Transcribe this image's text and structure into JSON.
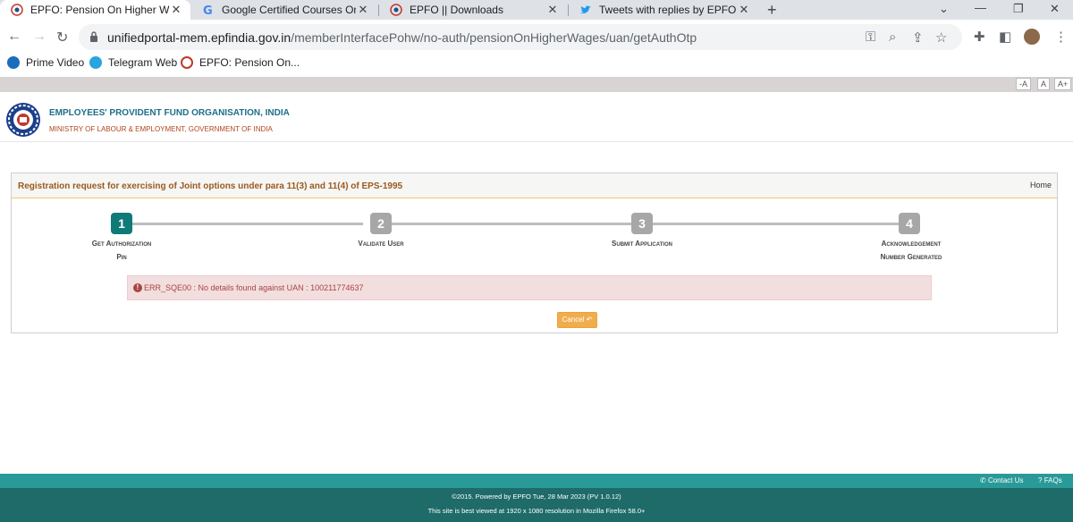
{
  "browser": {
    "tabs": [
      {
        "title": "EPFO: Pension On Higher Wages",
        "active": true
      },
      {
        "title": "Google Certified Courses Online",
        "active": false
      },
      {
        "title": "EPFO || Downloads",
        "active": false
      },
      {
        "title": "Tweets with replies by EPFO (@sc",
        "active": false
      }
    ],
    "new_tab": "+",
    "url_host": "unifiedportal-mem.epfindia.gov.in",
    "url_path": "/memberInterfacePohw/no-auth/pensionOnHigherWages/uan/getAuthOtp",
    "bookmarks": [
      "Prime Video",
      "Telegram Web",
      "EPFO: Pension On..."
    ]
  },
  "page": {
    "font_controls": [
      "-A",
      "A",
      "A+"
    ],
    "org_name": "EMPLOYEES' PROVIDENT FUND ORGANISATION, INDIA",
    "ministry": "MINISTRY OF LABOUR & EMPLOYMENT, GOVERNMENT OF INDIA",
    "panel_title": "Registration request for exercising of Joint options under para 11(3) and 11(4) of EPS-1995",
    "home_link": "Home",
    "steps": [
      {
        "number": "1",
        "label_line1": "Get Authorization",
        "label_line2": "Pin",
        "active": true
      },
      {
        "number": "2",
        "label_line1": "Validate User",
        "label_line2": "",
        "active": false
      },
      {
        "number": "3",
        "label_line1": "Submit Application",
        "label_line2": "",
        "active": false
      },
      {
        "number": "4",
        "label_line1": "Acknowledgement",
        "label_line2": "Number Generated",
        "active": false
      }
    ],
    "error_message": "ERR_SQE00 : No details found against UAN : 100211774637",
    "cancel_label": "Cancel"
  },
  "footer": {
    "contact_us": "Contact Us",
    "faqs": "FAQs",
    "copyright": "©2015. Powered by EPFO Tue, 28 Mar 2023 (PV 1.0.12)",
    "best_viewed": "This site is best viewed at 1920 x 1080 resolution in Mozilla Firefox 58.0+"
  },
  "colors": {
    "step_active": "#0f7a78",
    "step_inactive": "#a7a7a7",
    "footer_top": "#2a9a98",
    "footer_bottom": "#1f6b69",
    "cancel_button": "#f0ad4e",
    "alert_background": "#f2dede"
  }
}
